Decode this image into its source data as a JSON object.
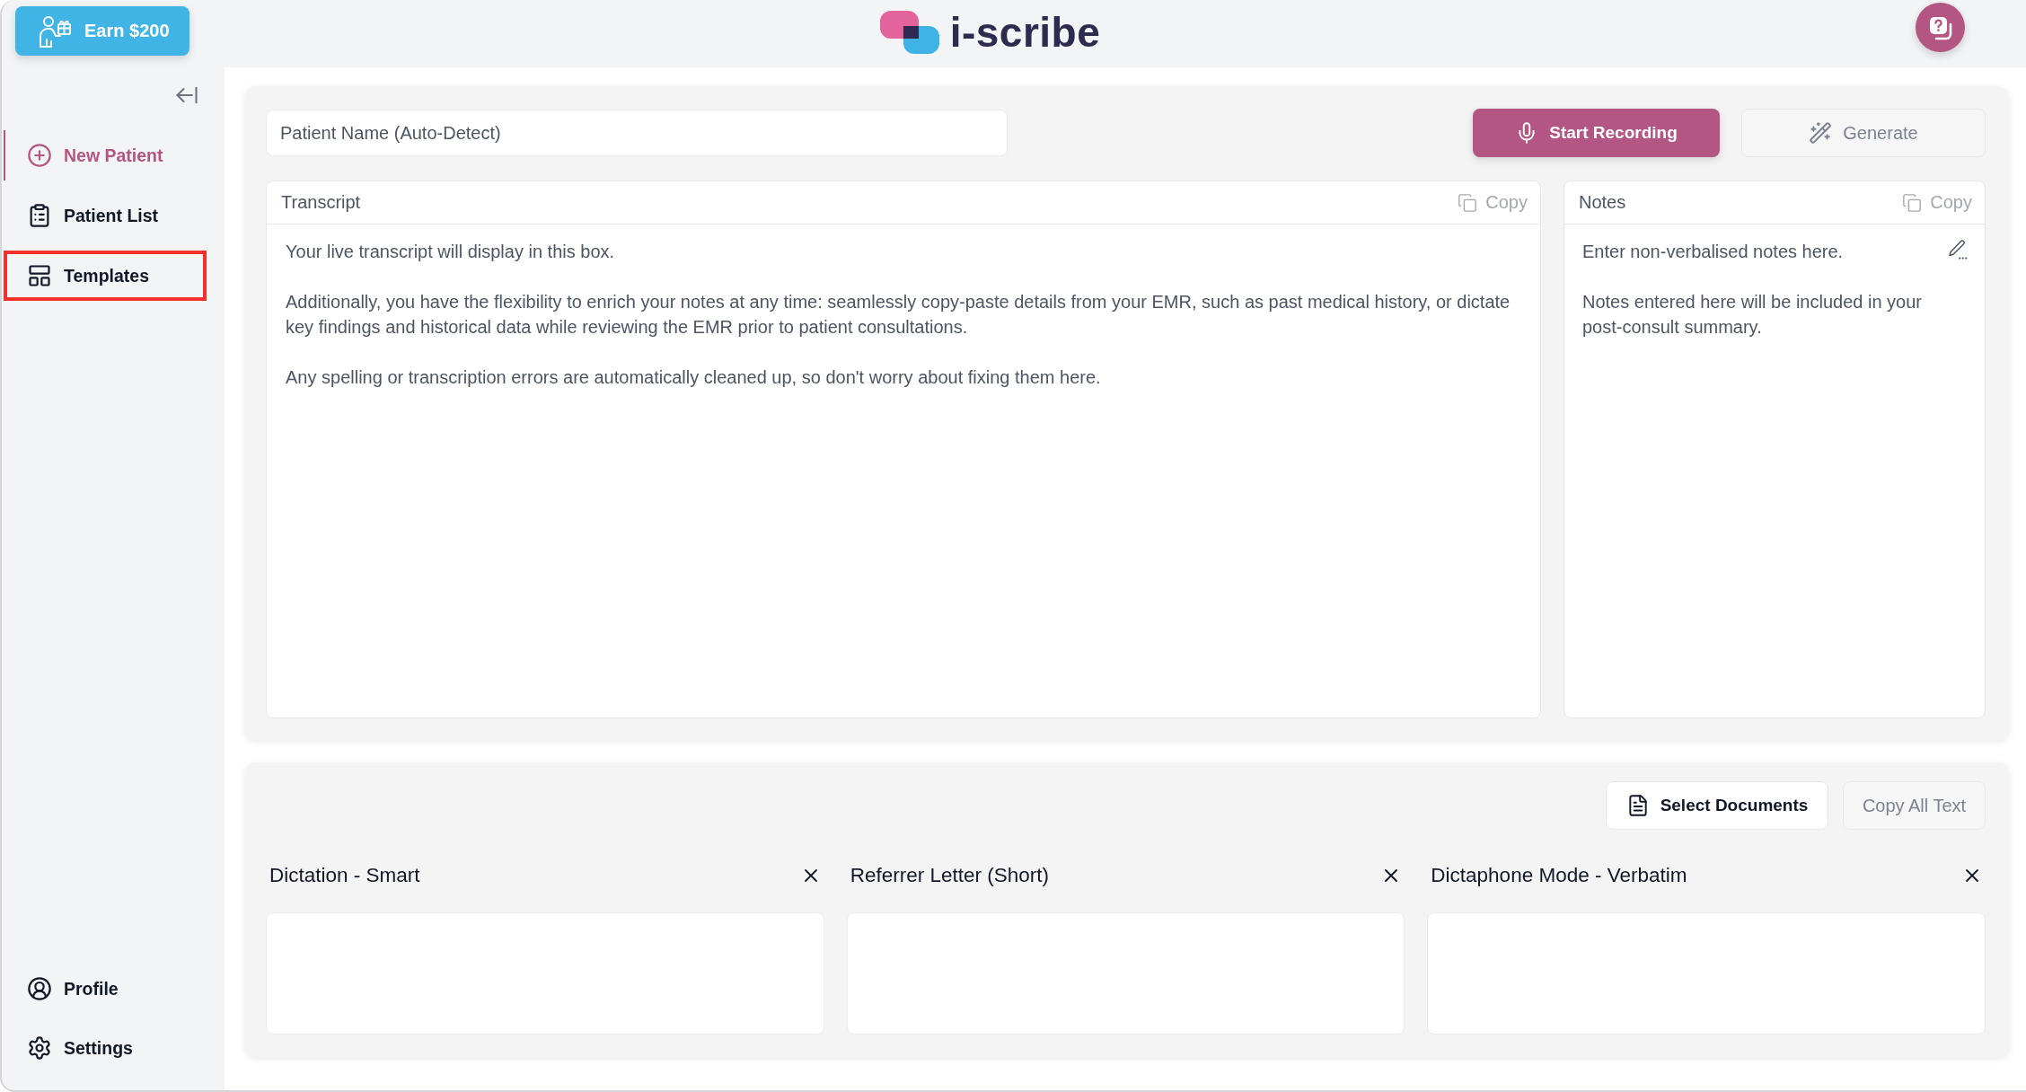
{
  "header": {
    "referral_button": {
      "label": "Earn $200"
    },
    "logo": {
      "text": "i-scribe"
    }
  },
  "sidebar": {
    "nav_items": [
      {
        "kind": "add",
        "label": "New Patient",
        "selected": true,
        "highlighted": false
      },
      {
        "kind": "list",
        "label": "Patient List",
        "selected": false,
        "highlighted": false
      },
      {
        "kind": "templates",
        "label": "Templates",
        "selected": false,
        "highlighted": true
      }
    ],
    "footer_items": [
      {
        "kind": "profile",
        "label": "Profile"
      },
      {
        "kind": "settings",
        "label": "Settings"
      }
    ]
  },
  "recording_panel": {
    "patient_name": {
      "placeholder": "Patient Name (Auto-Detect)"
    },
    "actions": [
      {
        "kind": "record",
        "label": "Start Recording",
        "disabled": false
      },
      {
        "kind": "generate",
        "label": "Generate",
        "disabled": true
      }
    ],
    "panels": [
      {
        "kind": "transcript",
        "title": "Transcript",
        "copy_button": {
          "label": "Copy",
          "disabled": true
        },
        "placeholder": [
          "Your live transcript will display in this box.",
          "Additionally, you have the flexibility to enrich your notes at any time: seamlessly copy-paste details from your EMR, such as past medical history, or dictate key findings and historical data while reviewing the EMR prior to patient consultations.",
          "Any spelling or transcription errors are automatically cleaned up, so don't worry about fixing them here."
        ]
      },
      {
        "kind": "notes",
        "title": "Notes",
        "copy_button": {
          "label": "Copy",
          "disabled": true
        },
        "placeholder": [
          "Enter non-verbalised notes here.",
          "Notes entered here will be included in your post-consult summary."
        ]
      }
    ]
  },
  "templates_panel": {
    "actions": [
      {
        "kind": "documents",
        "label": "Select Documents",
        "disabled": false
      },
      {
        "kind": "copy_all",
        "label": "Copy All Text",
        "disabled": true
      }
    ],
    "templates": [
      {
        "title": "Dictation - Smart"
      },
      {
        "title": "Referrer Letter (Short)"
      },
      {
        "title": "Dictaphone Mode - Verbatim"
      }
    ]
  }
}
